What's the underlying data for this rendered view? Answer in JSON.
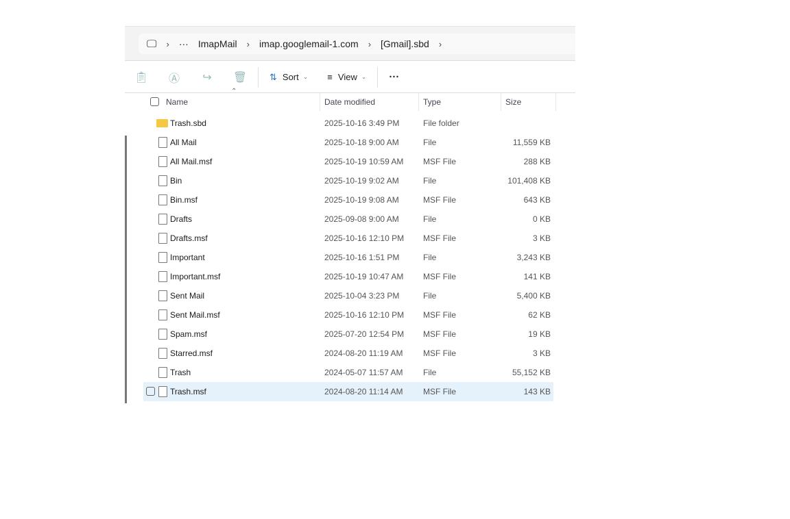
{
  "breadcrumb": {
    "items": [
      "ImapMail",
      "imap.googlemail-1.com",
      "[Gmail].sbd"
    ],
    "more": "···"
  },
  "toolbar": {
    "sort": "Sort",
    "view": "View",
    "more": "···"
  },
  "columns": {
    "name": "Name",
    "date": "Date modified",
    "type": "Type",
    "size": "Size"
  },
  "files": [
    {
      "name": "Trash.sbd",
      "date": "2025-10-16 3:49 PM",
      "type": "File folder",
      "size": "",
      "icon": "folder"
    },
    {
      "name": "All Mail",
      "date": "2025-10-18 9:00 AM",
      "type": "File",
      "size": "11,559 KB",
      "icon": "file"
    },
    {
      "name": "All Mail.msf",
      "date": "2025-10-19 10:59 AM",
      "type": "MSF File",
      "size": "288 KB",
      "icon": "file"
    },
    {
      "name": "Bin",
      "date": "2025-10-19 9:02 AM",
      "type": "File",
      "size": "101,408 KB",
      "icon": "file"
    },
    {
      "name": "Bin.msf",
      "date": "2025-10-19 9:08 AM",
      "type": "MSF File",
      "size": "643 KB",
      "icon": "file"
    },
    {
      "name": "Drafts",
      "date": "2025-09-08 9:00 AM",
      "type": "File",
      "size": "0 KB",
      "icon": "file"
    },
    {
      "name": "Drafts.msf",
      "date": "2025-10-16 12:10 PM",
      "type": "MSF File",
      "size": "3 KB",
      "icon": "file"
    },
    {
      "name": "Important",
      "date": "2025-10-16 1:51 PM",
      "type": "File",
      "size": "3,243 KB",
      "icon": "file"
    },
    {
      "name": "Important.msf",
      "date": "2025-10-19 10:47 AM",
      "type": "MSF File",
      "size": "141 KB",
      "icon": "file"
    },
    {
      "name": "Sent Mail",
      "date": "2025-10-04 3:23 PM",
      "type": "File",
      "size": "5,400 KB",
      "icon": "file"
    },
    {
      "name": "Sent Mail.msf",
      "date": "2025-10-16 12:10 PM",
      "type": "MSF File",
      "size": "62 KB",
      "icon": "file"
    },
    {
      "name": "Spam.msf",
      "date": "2025-07-20 12:54 PM",
      "type": "MSF File",
      "size": "19 KB",
      "icon": "file"
    },
    {
      "name": "Starred.msf",
      "date": "2024-08-20 11:19 AM",
      "type": "MSF File",
      "size": "3 KB",
      "icon": "file"
    },
    {
      "name": "Trash",
      "date": "2024-05-07 11:57 AM",
      "type": "File",
      "size": "55,152 KB",
      "icon": "file"
    },
    {
      "name": "Trash.msf",
      "date": "2024-08-20 11:14 AM",
      "type": "MSF File",
      "size": "143 KB",
      "icon": "file",
      "hovered": true
    }
  ]
}
